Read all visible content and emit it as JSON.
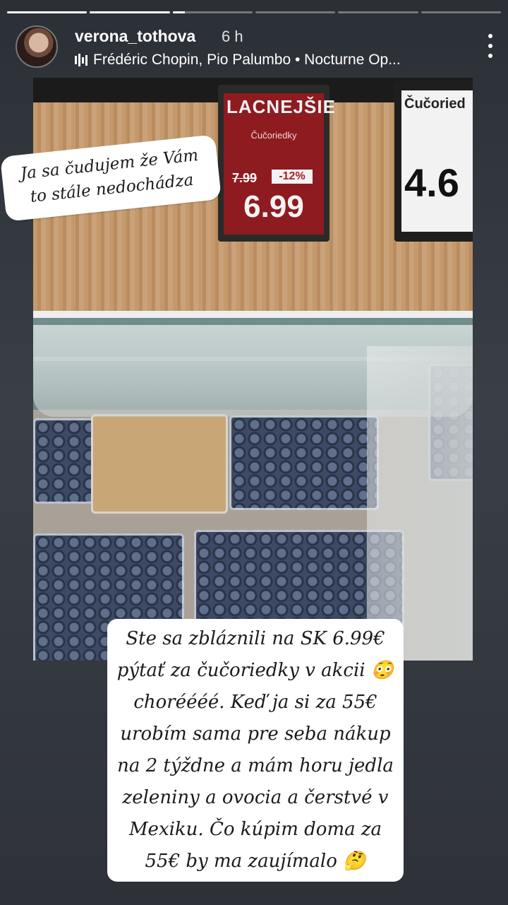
{
  "story": {
    "username": "verona_tothova",
    "time_ago": "6 h",
    "music": "Frédéric Chopin, Pio Palumbo • Nocturne Op...",
    "progress_segments": [
      1,
      1,
      0.15,
      0,
      0,
      0
    ]
  },
  "photo": {
    "price_tag_1": {
      "banner": "LACNEJŠIE",
      "product": "Čučoriedky",
      "old_price": "7.99",
      "discount": "-12%",
      "price": "6.99"
    },
    "price_tag_2": {
      "product": "Čučoried",
      "price": "4.6"
    }
  },
  "stickers": {
    "top_text": "Ja sa čudujem že Vám to stále nedochádza",
    "bottom_lines": [
      "Ste sa zbláznili na SK 6.99€",
      "pýtať za čučoriedky v akcii 😳",
      "choréééé. Keď ja si za 55€",
      "urobím sama pre seba nákup",
      "na 2 týždne a mám horu jedla",
      "zeleniny a ovocia a čerstvé v",
      "Mexiku. Čo kúpim doma za",
      "55€ by ma zaujímalo 🤔"
    ]
  }
}
